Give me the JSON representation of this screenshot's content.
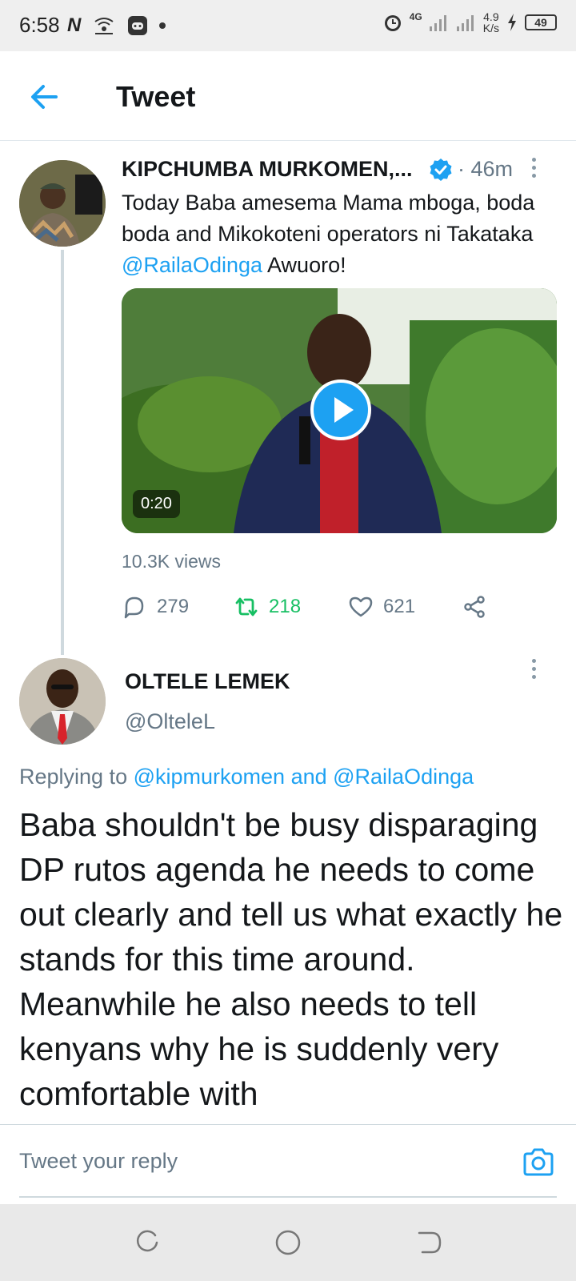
{
  "status_bar": {
    "time": "6:58",
    "network_letter": "N",
    "network_type": "4G",
    "speed_value": "4.9",
    "speed_unit": "K/s",
    "battery": "49",
    "icons": [
      "netflix-icon",
      "carrier-icon",
      "game-icon",
      "alarm-icon",
      "signal-icon",
      "charging-icon",
      "battery-icon"
    ]
  },
  "header": {
    "title": "Tweet",
    "back_icon": "arrow-left-icon"
  },
  "tweet1": {
    "author": "KIPCHUMBA MURKOMEN,...",
    "verified": true,
    "time": "· 46m",
    "text_before": "Today Baba amesema Mama mboga, boda boda and Mikokoteni operators ni Takataka ",
    "mention": "@RailaOdinga",
    "text_after": " Awuoro!",
    "video_duration": "0:20",
    "views": "10.3K views",
    "stats": {
      "replies": "279",
      "retweets": "218",
      "likes": "621"
    }
  },
  "tweet2": {
    "author": "OLTELE LEMEK",
    "handle": "@OlteleL",
    "replying_prefix": "Replying to ",
    "replying_user1": "@kipmurkomen",
    "replying_and": " and ",
    "replying_user2": "@RailaOdinga",
    "text": "Baba shouldn't be busy disparaging DP rutos agenda he needs to come out clearly and tell us what exactly he stands for this time around. Meanwhile he also needs to tell kenyans why he is suddenly very comfortable with"
  },
  "reply_bar": {
    "placeholder": "Tweet your reply"
  },
  "colors": {
    "accent": "#1da1f2",
    "retweet_active": "#17bf63",
    "secondary_text": "#657786"
  }
}
